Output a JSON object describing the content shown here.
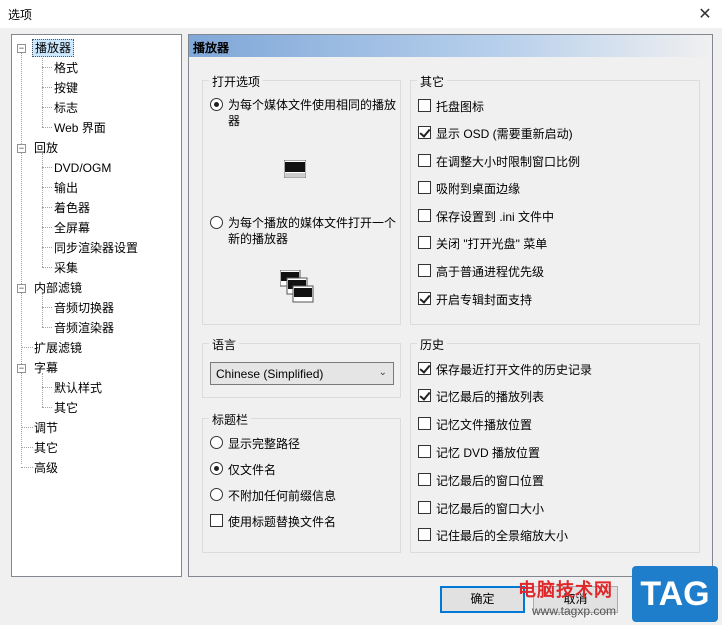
{
  "window": {
    "title": "选项",
    "close_label": "✕"
  },
  "tree": {
    "items": [
      "播放器",
      "格式",
      "按键",
      "标志",
      "Web 界面",
      "回放",
      "DVD/OGM",
      "输出",
      "着色器",
      "全屏幕",
      "同步渲染器设置",
      "采集",
      "内部滤镜",
      "音频切换器",
      "音频渲染器",
      "扩展滤镜",
      "字幕",
      "默认样式",
      "其它",
      "调节",
      "其它",
      "高级"
    ],
    "expand_symbol": "−"
  },
  "page": {
    "header": "播放器",
    "open_options": {
      "title": "打开选项",
      "same_player": "为每个媒体文件使用相同的播放器",
      "new_player": "为每个播放的媒体文件打开一个新的播放器"
    },
    "other": {
      "title": "其它",
      "items": [
        {
          "label": "托盘图标",
          "checked": false
        },
        {
          "label": "显示 OSD (需要重新启动)",
          "checked": true
        },
        {
          "label": "在调整大小时限制窗口比例",
          "checked": false
        },
        {
          "label": "吸附到桌面边缘",
          "checked": false
        },
        {
          "label": "保存设置到 .ini 文件中",
          "checked": false
        },
        {
          "label": "关闭 \"打开光盘\" 菜单",
          "checked": false
        },
        {
          "label": "高于普通进程优先级",
          "checked": false
        },
        {
          "label": "开启专辑封面支持",
          "checked": true
        }
      ]
    },
    "language": {
      "title": "语言",
      "selected": "Chinese (Simplified)",
      "arrow": "⌄"
    },
    "titlebar": {
      "title": "标题栏",
      "full_path": "显示完整路径",
      "file_name": "仅文件名",
      "no_prefix": "不附加任何前缀信息",
      "use_subtitle": "使用标题替换文件名"
    },
    "history": {
      "title": "历史",
      "items": [
        {
          "label": "保存最近打开文件的历史记录",
          "checked": true
        },
        {
          "label": "记忆最后的播放列表",
          "checked": true
        },
        {
          "label": "记忆文件播放位置",
          "checked": false
        },
        {
          "label": "记忆 DVD 播放位置",
          "checked": false
        },
        {
          "label": "记忆最后的窗口位置",
          "checked": false
        },
        {
          "label": "记忆最后的窗口大小",
          "checked": false
        },
        {
          "label": "记住最后的全景缩放大小",
          "checked": false
        }
      ]
    }
  },
  "buttons": {
    "ok": "确定",
    "cancel": "取消"
  },
  "watermark": {
    "site": "电脑技术网",
    "url": "www.tagxp.com",
    "tag": "TAG"
  }
}
